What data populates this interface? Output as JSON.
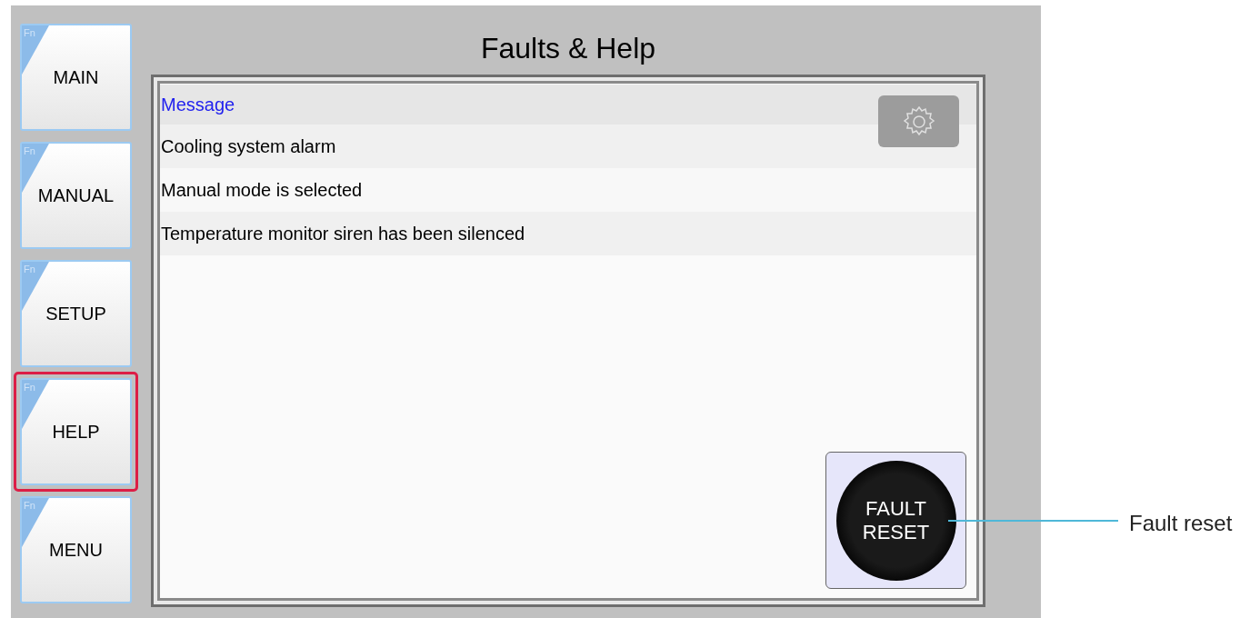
{
  "nav_buttons": [
    {
      "label": "MAIN",
      "fn_label": "Fn",
      "selected": false
    },
    {
      "label": "MANUAL",
      "fn_label": "Fn",
      "selected": false
    },
    {
      "label": "SETUP",
      "fn_label": "Fn",
      "selected": false
    },
    {
      "label": "HELP",
      "fn_label": "Fn",
      "selected": true
    },
    {
      "label": "MENU",
      "fn_label": "Fn",
      "selected": false
    }
  ],
  "title": "Faults & Help",
  "messages": {
    "header": "Message",
    "rows": [
      "Cooling system alarm",
      "Manual mode is selected",
      "Temperature monitor siren has been silenced"
    ]
  },
  "fault_reset_button": {
    "label": "FAULT RESET"
  },
  "annotation": {
    "label": "Fault reset"
  }
}
